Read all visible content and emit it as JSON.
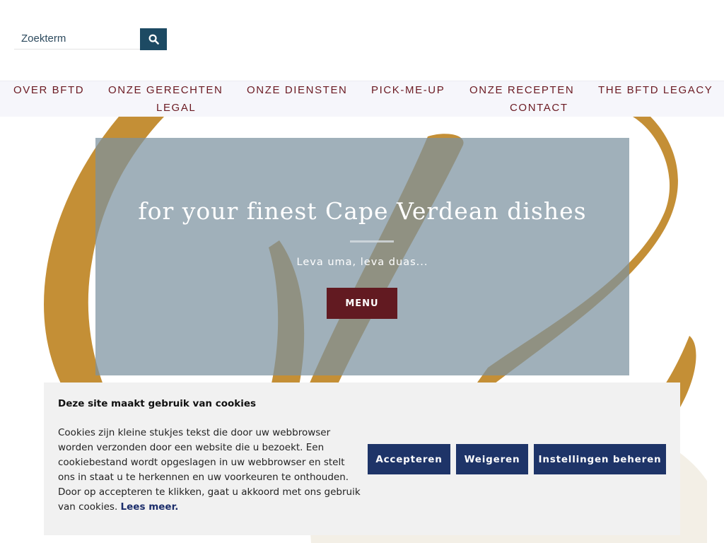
{
  "search": {
    "placeholder": "Zoekterm",
    "button_icon": "search-icon"
  },
  "nav": {
    "items": [
      "OVER BFTD",
      "ONZE GERECHTEN",
      "ONZE DIENSTEN",
      "PICK-ME-UP",
      "ONZE RECEPTEN",
      "THE BFTD LEGACY",
      "LEGAL",
      "CONTACT"
    ]
  },
  "hero": {
    "title": "for your finest Cape Verdean dishes",
    "subtitle": "Leva uma, leva duas...",
    "button_label": "MENU"
  },
  "cookie": {
    "title": "Deze site maakt gebruik van cookies",
    "text": "Cookies zijn kleine stukjes tekst die door uw webbrowser worden verzonden door een website die u bezoekt. Een cookiebestand wordt opgeslagen in uw webbrowser en stelt ons in staat u te herkennen en uw voorkeuren te onthouden. Door op accepteren te klikken, gaat u akkoord met ons gebruik van cookies.",
    "read_more": "Lees meer.",
    "accept_label": "Accepteren",
    "reject_label": "Weigeren",
    "settings_label": "Instellingen beheren"
  },
  "colors": {
    "nav_text": "#6b1a22",
    "search_button": "#1d4a63",
    "menu_button": "#621a21",
    "cookie_button": "#1e3468",
    "logo_gold": "#c48f36"
  }
}
